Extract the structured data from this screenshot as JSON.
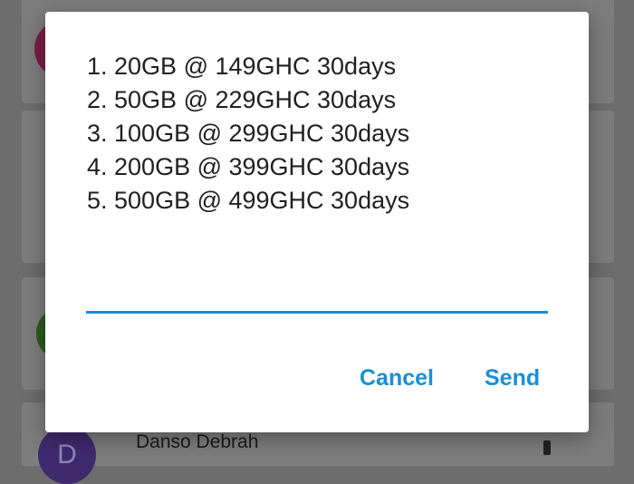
{
  "background": {
    "contact_initial": "D",
    "contact_name": "Danso Debrah"
  },
  "dialog": {
    "lines": [
      "1. 20GB @ 149GHC 30days",
      "2. 50GB @ 229GHC 30days",
      "3. 100GB @ 299GHC 30days",
      "4. 200GB @ 399GHC 30days",
      "5. 500GB @ 499GHC 30days"
    ],
    "input_value": "",
    "cancel_label": "Cancel",
    "send_label": "Send"
  },
  "colors": {
    "accent": "#1a8fd6",
    "text": "#212121",
    "scrim": "#6d6d6d"
  }
}
